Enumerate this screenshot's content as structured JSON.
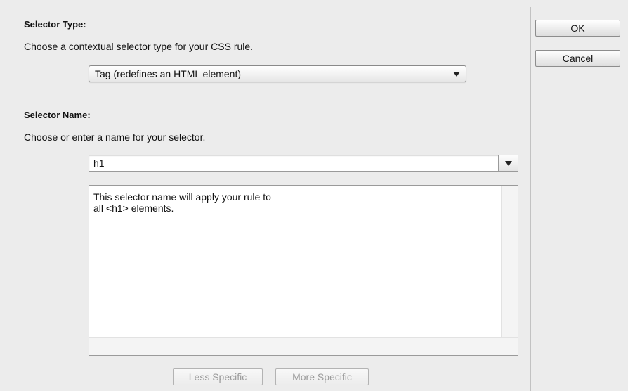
{
  "selector_type": {
    "heading": "Selector Type:",
    "instruction": "Choose a contextual selector type for your CSS rule.",
    "selected": "Tag (redefines an HTML element)"
  },
  "selector_name": {
    "heading": "Selector Name:",
    "instruction": "Choose or enter a name for your selector.",
    "value": "h1",
    "description_lines": [
      "This selector name will apply your rule to",
      "all <h1> elements."
    ]
  },
  "buttons": {
    "ok": "OK",
    "cancel": "Cancel",
    "less_specific": "Less Specific",
    "more_specific": "More Specific"
  },
  "icons": {
    "popup_arrow": "chevron-down-icon",
    "combo_arrow": "chevron-down-icon"
  }
}
